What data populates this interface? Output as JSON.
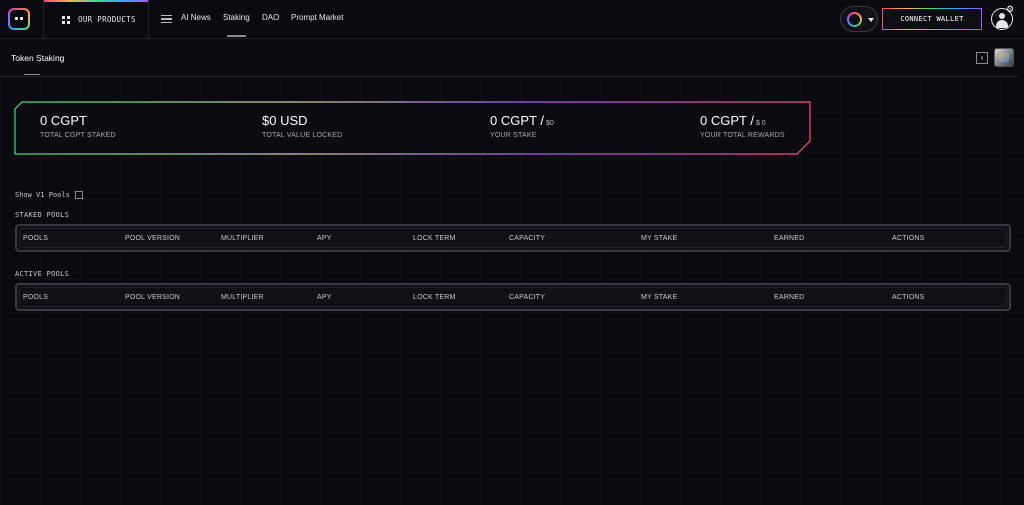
{
  "nav": {
    "products_label": "OUR PRODUCTS",
    "links": [
      "AI News",
      "Staking",
      "DAO",
      "Prompt Market"
    ],
    "active_link": "Staking",
    "connect_label": "CONNECT WALLET"
  },
  "page": {
    "title": "Token Staking"
  },
  "stats": [
    {
      "value": "0 CGPT",
      "suffix": "",
      "label": "TOTAL CGPT STAKED"
    },
    {
      "value": "$0 USD",
      "suffix": "",
      "label": "TOTAL VALUE LOCKED"
    },
    {
      "value": "0 CGPT /",
      "suffix": "$0",
      "label": "YOUR STAKE"
    },
    {
      "value": "0 CGPT /",
      "suffix": "$ 0",
      "label": "YOUR TOTAL REWARDS"
    }
  ],
  "pools": {
    "show_v1_label": "Show V1 Pools",
    "show_v1_checked": false,
    "staked_label": "STAKED POOLS",
    "active_label": "ACTIVE POOLS",
    "columns": [
      "POOLS",
      "POOL VERSION",
      "MULTIPLIER",
      "APY",
      "LOCK TERM",
      "CAPACITY",
      "MY STAKE",
      "EARNED",
      "ACTIONS"
    ]
  },
  "colors": {
    "background": "#0b0a10",
    "accent_gradient": [
      "#ff4d6d",
      "#ffb347",
      "#3ddc84",
      "#36a2ff",
      "#a45bff"
    ]
  },
  "icons": [
    "logo-icon",
    "grid-dots-icon",
    "menu-icon",
    "chain-icon",
    "chevron-down-icon",
    "user-icon",
    "gear-icon",
    "chevron-left-icon",
    "cube-icon"
  ]
}
